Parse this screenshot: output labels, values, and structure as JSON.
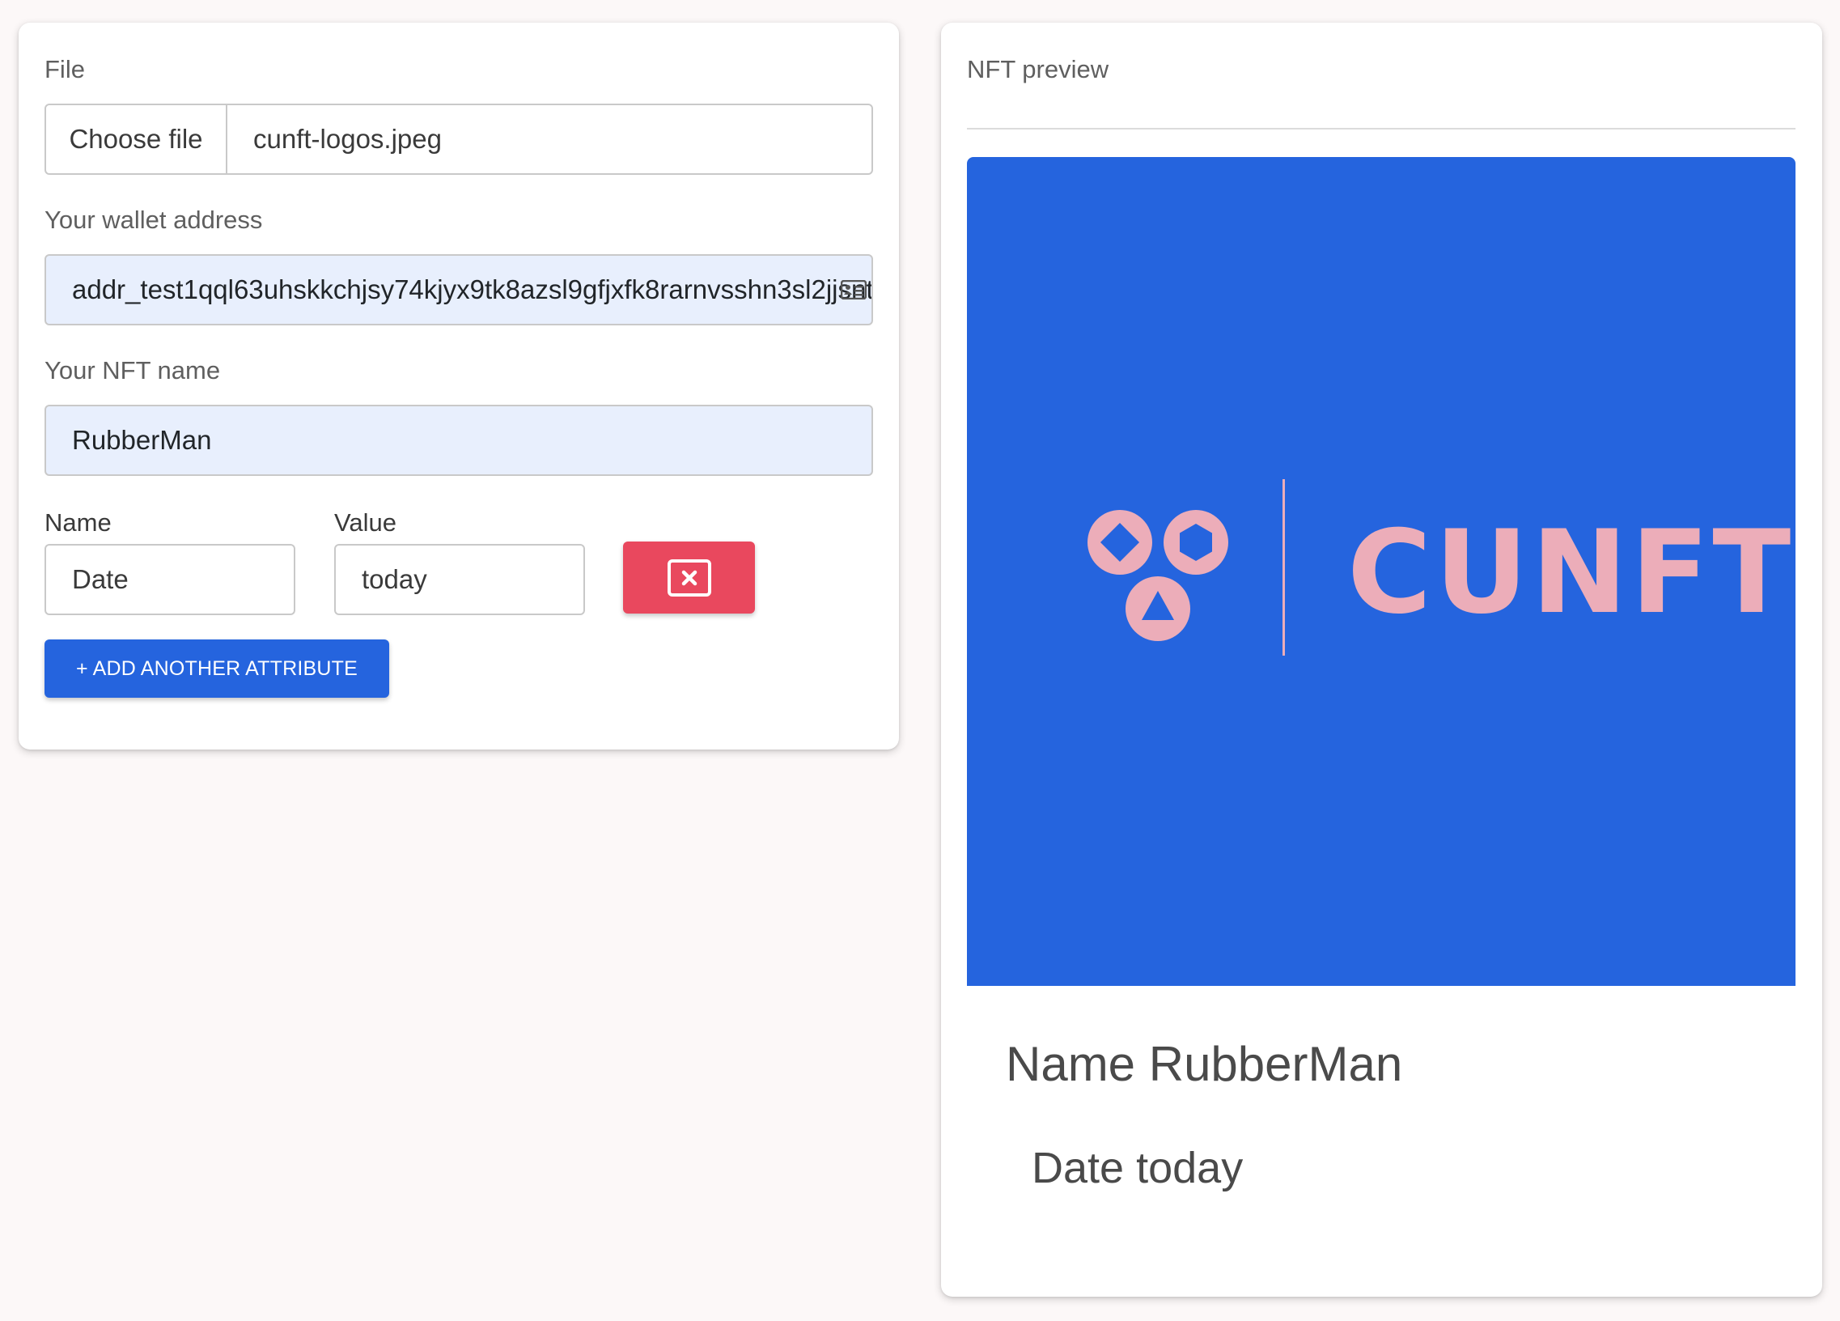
{
  "form": {
    "file_label": "File",
    "choose_file_label": "Choose file",
    "file_name": "cunft-logos.jpeg",
    "wallet_label": "Your wallet address",
    "wallet_value": "addr_test1qql63uhskkchjsy74kjyx9tk8azsl9gfjxfk8rarnvsshn3sl2jjsnt",
    "nft_name_label": "Your NFT name",
    "nft_name_value": "RubberMan",
    "attributes": {
      "name_header": "Name",
      "value_header": "Value",
      "rows": [
        {
          "name": "Date",
          "value": "today"
        }
      ]
    },
    "add_attribute_label": "+ ADD ANOTHER ATTRIBUTE"
  },
  "preview": {
    "title": "NFT preview",
    "image_text": "CUNFT",
    "name_prefix": "Name",
    "name_value": "RubberMan",
    "attr_line_name": "Date",
    "attr_line_value": "today"
  },
  "colors": {
    "primary": "#2564de",
    "danger": "#e9485e",
    "logo_pink": "#ecadb9",
    "autofill_bg": "#e8effd"
  },
  "icons": {
    "wallet_field": "contact-card-icon",
    "remove_attribute": "close-box-icon"
  }
}
